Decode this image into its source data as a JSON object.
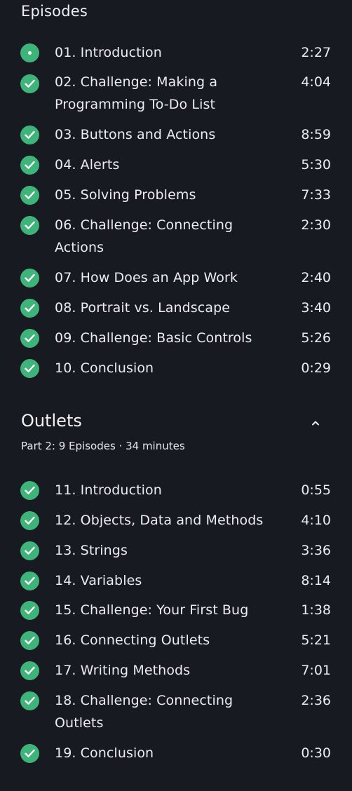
{
  "section1": {
    "title": "Episodes",
    "episodes": [
      {
        "title": "01. Introduction",
        "duration": "2:27",
        "status": "in-progress"
      },
      {
        "title": "02. Challenge: Making a Programming To-Do List",
        "duration": "4:04",
        "status": "completed"
      },
      {
        "title": "03. Buttons and Actions",
        "duration": "8:59",
        "status": "completed"
      },
      {
        "title": "04. Alerts",
        "duration": "5:30",
        "status": "completed"
      },
      {
        "title": "05. Solving Problems",
        "duration": "7:33",
        "status": "completed"
      },
      {
        "title": "06. Challenge: Connecting Actions",
        "duration": "2:30",
        "status": "completed"
      },
      {
        "title": "07. How Does an App Work",
        "duration": "2:40",
        "status": "completed"
      },
      {
        "title": "08. Portrait vs. Landscape",
        "duration": "3:40",
        "status": "completed"
      },
      {
        "title": "09. Challenge: Basic Controls",
        "duration": "5:26",
        "status": "completed"
      },
      {
        "title": "10. Conclusion",
        "duration": "0:29",
        "status": "completed"
      }
    ]
  },
  "section2": {
    "title": "Outlets",
    "meta": "Part 2: 9 Episodes · 34 minutes",
    "collapse_icon": "chevron-up-icon",
    "episodes": [
      {
        "title": "11. Introduction",
        "duration": "0:55",
        "status": "completed"
      },
      {
        "title": "12. Objects, Data and Methods",
        "duration": "4:10",
        "status": "completed"
      },
      {
        "title": "13. Strings",
        "duration": "3:36",
        "status": "completed"
      },
      {
        "title": "14. Variables",
        "duration": "8:14",
        "status": "completed"
      },
      {
        "title": "15. Challenge: Your First Bug",
        "duration": "1:38",
        "status": "completed"
      },
      {
        "title": "16. Connecting Outlets",
        "duration": "5:21",
        "status": "completed"
      },
      {
        "title": "17. Writing Methods",
        "duration": "7:01",
        "status": "completed"
      },
      {
        "title": "18. Challenge: Connecting Outlets",
        "duration": "2:36",
        "status": "completed"
      },
      {
        "title": "19. Conclusion",
        "duration": "0:30",
        "status": "completed"
      }
    ]
  },
  "colors": {
    "background": "#171b21",
    "accent_green": "#3fb47a",
    "text": "#eaecef"
  }
}
